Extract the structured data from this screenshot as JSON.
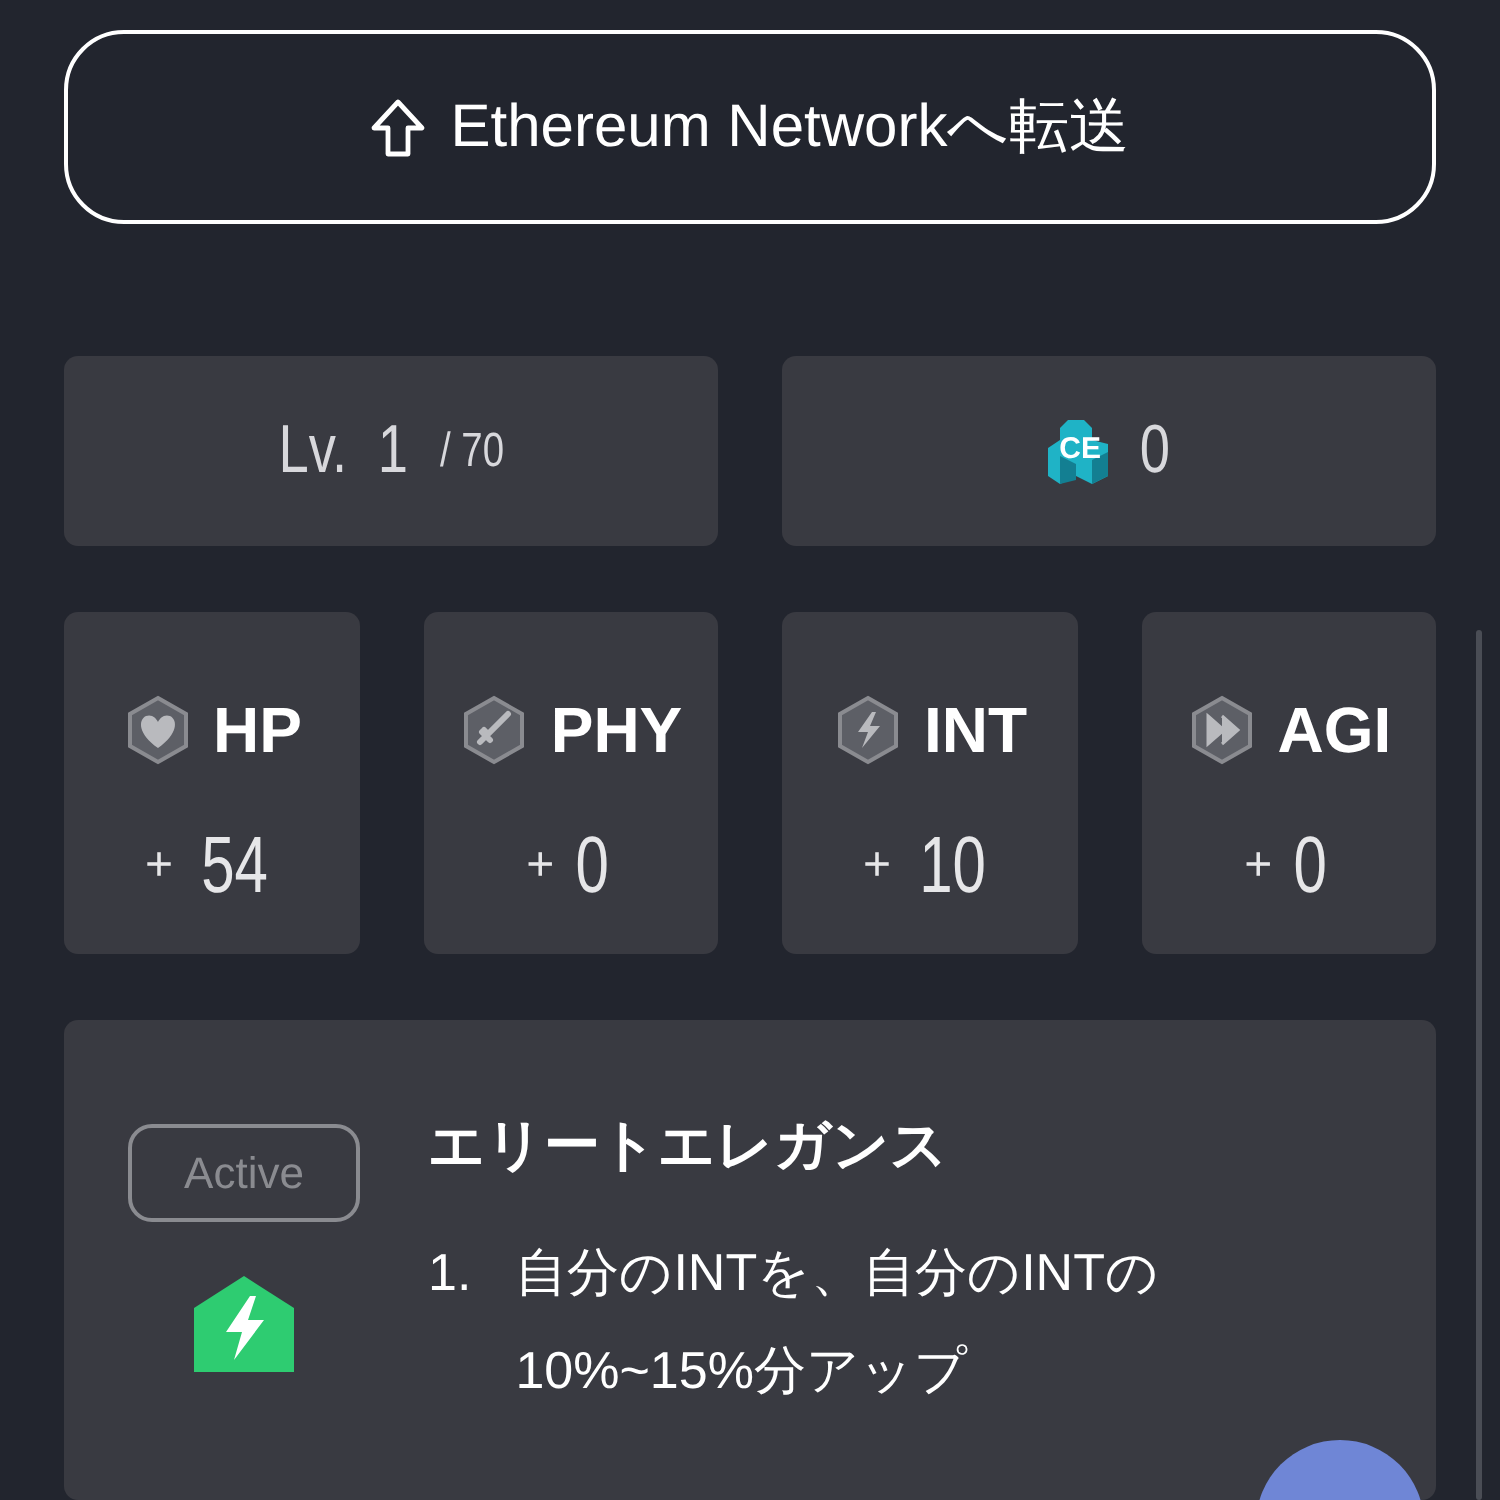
{
  "transfer_button": {
    "label": "Ethereum Networkへ転送"
  },
  "level": {
    "prefix": "Lv.",
    "value": "1",
    "max": "/ 70"
  },
  "ce": {
    "badge": "CE",
    "value": "0"
  },
  "stats": [
    {
      "kind": "hp",
      "label": "HP",
      "sign": "+",
      "value": "54"
    },
    {
      "kind": "phy",
      "label": "PHY",
      "sign": "+",
      "value": "0"
    },
    {
      "kind": "int",
      "label": "INT",
      "sign": "+",
      "value": "10"
    },
    {
      "kind": "agi",
      "label": "AGI",
      "sign": "+",
      "value": "0"
    }
  ],
  "skill": {
    "status": "Active",
    "title": "エリートエレガンス",
    "effects": [
      {
        "number": "1.",
        "text": "自分のINTを、自分のINTの10%~15%分アップ"
      }
    ]
  }
}
